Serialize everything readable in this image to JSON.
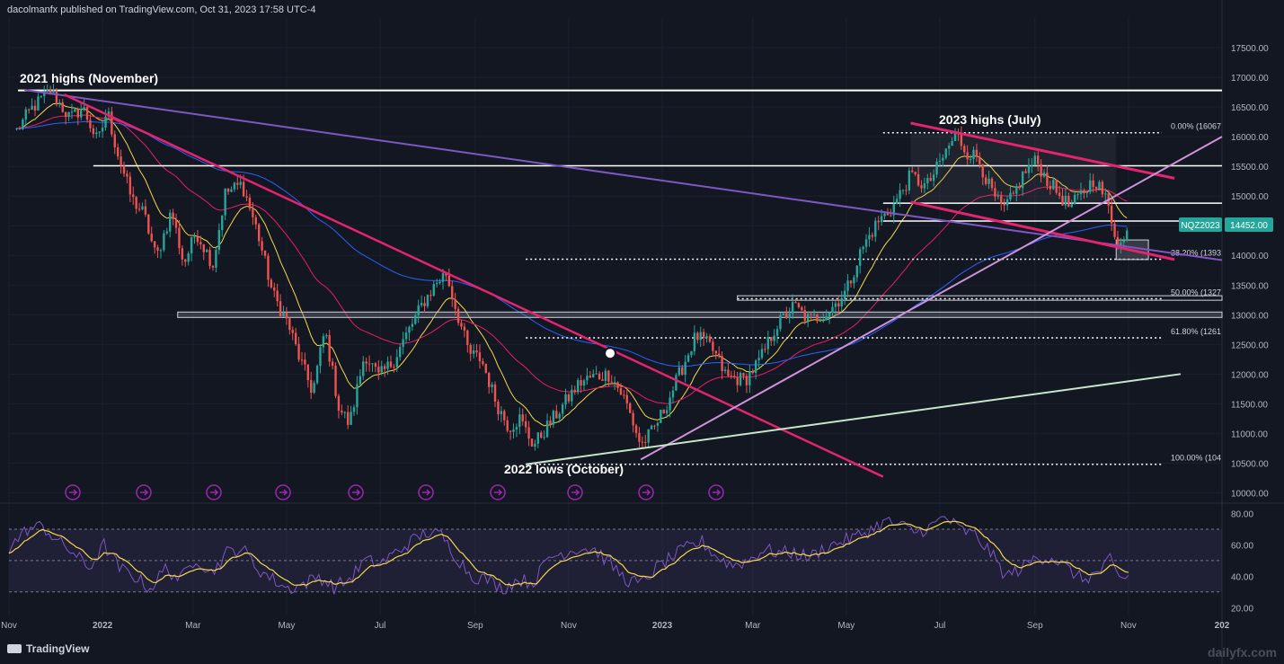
{
  "header": {
    "published": "dacolmanfx published on TradingView.com, Oct 31, 2023 17:58 UTC-4"
  },
  "branding": {
    "logo_text": "TradingView",
    "watermark": "dailyfx.com"
  },
  "colors": {
    "background": "#131722",
    "up": "#26a69a",
    "down": "#ef5350",
    "ema_fast": "#f5d84a",
    "ema_mid": "#e91e63",
    "ema_slow": "#2962ff",
    "channel": "#e3246f",
    "trend_long": "#7e57c2",
    "support_line": "#ce93d8",
    "lows_line": "#c8e6c9"
  },
  "annotations": {
    "highs2021": "2021 highs (November)",
    "highs2023": "2023 highs (July)",
    "lows2022": "2022 lows (October)"
  },
  "chart_data": {
    "type": "candlestick",
    "symbol": "NQZ2023",
    "last_price": "14452.00",
    "price_axis": {
      "ticks": [
        "17500.00",
        "17000.00",
        "16500.00",
        "16000.00",
        "15500.00",
        "15000.00",
        "14500.00",
        "14000.00",
        "13500.00",
        "13000.00",
        "12500.00",
        "12000.00",
        "11500.00",
        "11000.00",
        "10500.00",
        "10000.00"
      ],
      "range": [
        9900,
        17850
      ]
    },
    "rsi_axis": {
      "ticks": [
        "80.00",
        "60.00",
        "40.00",
        "20.00"
      ],
      "range": [
        15,
        82
      ],
      "band": [
        30,
        70
      ]
    },
    "time_axis": [
      {
        "label": "Nov",
        "day": 0
      },
      {
        "label": "2022",
        "day": 61
      },
      {
        "label": "Mar",
        "day": 120
      },
      {
        "label": "May",
        "day": 181
      },
      {
        "label": "Jul",
        "day": 242
      },
      {
        "label": "Sep",
        "day": 304
      },
      {
        "label": "Nov",
        "day": 365
      },
      {
        "label": "2023",
        "day": 426
      },
      {
        "label": "Mar",
        "day": 485
      },
      {
        "label": "May",
        "day": 546
      },
      {
        "label": "Jul",
        "day": 607
      },
      {
        "label": "Sep",
        "day": 669
      },
      {
        "label": "Nov",
        "day": 730
      },
      {
        "label": "202",
        "day": 791
      }
    ],
    "fibonacci": [
      {
        "label": "0.00% (16067",
        "value": 16067
      },
      {
        "label": "38.20% (1393",
        "value": 13935
      },
      {
        "label": "50.00% (1327",
        "value": 13270
      },
      {
        "label": "61.80% (1261",
        "value": 12610
      },
      {
        "label": "100.00% (104",
        "value": 10480
      }
    ],
    "horizontal_levels": [
      16780,
      15510,
      14880,
      14580,
      13000
    ],
    "trendlines": [
      {
        "name": "long-term-down",
        "from": [
          10,
          16790
        ],
        "to": [
          791,
          13920
        ]
      },
      {
        "name": "down-2021-2022",
        "from": [
          36,
          16710
        ],
        "to": [
          570,
          10270
        ]
      },
      {
        "name": "channel-upper",
        "from": [
          588,
          16230
        ],
        "to": [
          760,
          15300
        ]
      },
      {
        "name": "channel-lower",
        "from": [
          588,
          14900
        ],
        "to": [
          760,
          13930
        ]
      },
      {
        "name": "rising-support",
        "from": [
          412,
          10560
        ],
        "to": [
          791,
          16000
        ]
      },
      {
        "name": "lows-support",
        "from": [
          337,
          10480
        ],
        "to": [
          764,
          12000
        ]
      }
    ],
    "anchors": [
      [
        5,
        16100
      ],
      [
        14,
        16450
      ],
      [
        27,
        16780
      ],
      [
        40,
        16300
      ],
      [
        48,
        16500
      ],
      [
        58,
        15900
      ],
      [
        64,
        16450
      ],
      [
        70,
        15800
      ],
      [
        80,
        14950
      ],
      [
        88,
        14700
      ],
      [
        96,
        13950
      ],
      [
        106,
        14750
      ],
      [
        114,
        13850
      ],
      [
        122,
        14400
      ],
      [
        133,
        13850
      ],
      [
        141,
        15050
      ],
      [
        152,
        15200
      ],
      [
        162,
        14400
      ],
      [
        172,
        13350
      ],
      [
        182,
        12850
      ],
      [
        189,
        12300
      ],
      [
        198,
        11700
      ],
      [
        206,
        12750
      ],
      [
        215,
        11450
      ],
      [
        222,
        11150
      ],
      [
        232,
        12350
      ],
      [
        241,
        11950
      ],
      [
        250,
        12200
      ],
      [
        260,
        12700
      ],
      [
        270,
        13200
      ],
      [
        279,
        13550
      ],
      [
        285,
        13700
      ],
      [
        292,
        13050
      ],
      [
        300,
        12350
      ],
      [
        308,
        12250
      ],
      [
        318,
        11500
      ],
      [
        326,
        11100
      ],
      [
        333,
        11250
      ],
      [
        342,
        10800
      ],
      [
        352,
        11150
      ],
      [
        362,
        11500
      ],
      [
        372,
        11850
      ],
      [
        380,
        11950
      ],
      [
        392,
        12000
      ],
      [
        402,
        11550
      ],
      [
        412,
        10800
      ],
      [
        420,
        11050
      ],
      [
        428,
        11450
      ],
      [
        438,
        12050
      ],
      [
        448,
        12650
      ],
      [
        458,
        12450
      ],
      [
        468,
        11950
      ],
      [
        480,
        11900
      ],
      [
        490,
        12250
      ],
      [
        500,
        12800
      ],
      [
        512,
        13150
      ],
      [
        522,
        12900
      ],
      [
        534,
        13050
      ],
      [
        546,
        13400
      ],
      [
        556,
        14100
      ],
      [
        566,
        14550
      ],
      [
        576,
        14800
      ],
      [
        588,
        15350
      ],
      [
        598,
        15150
      ],
      [
        606,
        15500
      ],
      [
        612,
        15800
      ],
      [
        618,
        16050
      ],
      [
        624,
        15750
      ],
      [
        632,
        15650
      ],
      [
        640,
        15100
      ],
      [
        648,
        14750
      ],
      [
        655,
        15000
      ],
      [
        662,
        15400
      ],
      [
        670,
        15600
      ],
      [
        676,
        15300
      ],
      [
        684,
        15050
      ],
      [
        692,
        14800
      ],
      [
        700,
        15050
      ],
      [
        708,
        15300
      ],
      [
        716,
        14900
      ],
      [
        722,
        14300
      ],
      [
        726,
        14160
      ],
      [
        730,
        14450
      ]
    ],
    "rsi_anchors": [
      [
        0,
        58
      ],
      [
        12,
        70
      ],
      [
        22,
        72
      ],
      [
        32,
        62
      ],
      [
        42,
        55
      ],
      [
        52,
        45
      ],
      [
        62,
        60
      ],
      [
        72,
        45
      ],
      [
        82,
        40
      ],
      [
        92,
        32
      ],
      [
        102,
        45
      ],
      [
        112,
        38
      ],
      [
        122,
        52
      ],
      [
        132,
        42
      ],
      [
        142,
        55
      ],
      [
        152,
        58
      ],
      [
        162,
        45
      ],
      [
        172,
        38
      ],
      [
        182,
        32
      ],
      [
        192,
        35
      ],
      [
        202,
        40
      ],
      [
        212,
        33
      ],
      [
        222,
        38
      ],
      [
        232,
        50
      ],
      [
        242,
        48
      ],
      [
        252,
        55
      ],
      [
        262,
        62
      ],
      [
        272,
        68
      ],
      [
        282,
        66
      ],
      [
        292,
        52
      ],
      [
        302,
        40
      ],
      [
        312,
        38
      ],
      [
        322,
        32
      ],
      [
        332,
        38
      ],
      [
        342,
        36
      ],
      [
        352,
        52
      ],
      [
        362,
        55
      ],
      [
        372,
        58
      ],
      [
        382,
        57
      ],
      [
        392,
        48
      ],
      [
        402,
        38
      ],
      [
        412,
        35
      ],
      [
        422,
        45
      ],
      [
        432,
        52
      ],
      [
        442,
        58
      ],
      [
        452,
        62
      ],
      [
        462,
        52
      ],
      [
        472,
        47
      ],
      [
        482,
        50
      ],
      [
        492,
        57
      ],
      [
        502,
        55
      ],
      [
        512,
        55
      ],
      [
        522,
        52
      ],
      [
        532,
        58
      ],
      [
        542,
        62
      ],
      [
        552,
        65
      ],
      [
        562,
        70
      ],
      [
        572,
        75
      ],
      [
        582,
        72
      ],
      [
        592,
        68
      ],
      [
        602,
        72
      ],
      [
        610,
        78
      ],
      [
        620,
        70
      ],
      [
        630,
        66
      ],
      [
        640,
        55
      ],
      [
        650,
        40
      ],
      [
        660,
        45
      ],
      [
        670,
        52
      ],
      [
        680,
        52
      ],
      [
        690,
        45
      ],
      [
        700,
        38
      ],
      [
        710,
        42
      ],
      [
        718,
        50
      ],
      [
        724,
        38
      ],
      [
        730,
        40
      ]
    ]
  }
}
